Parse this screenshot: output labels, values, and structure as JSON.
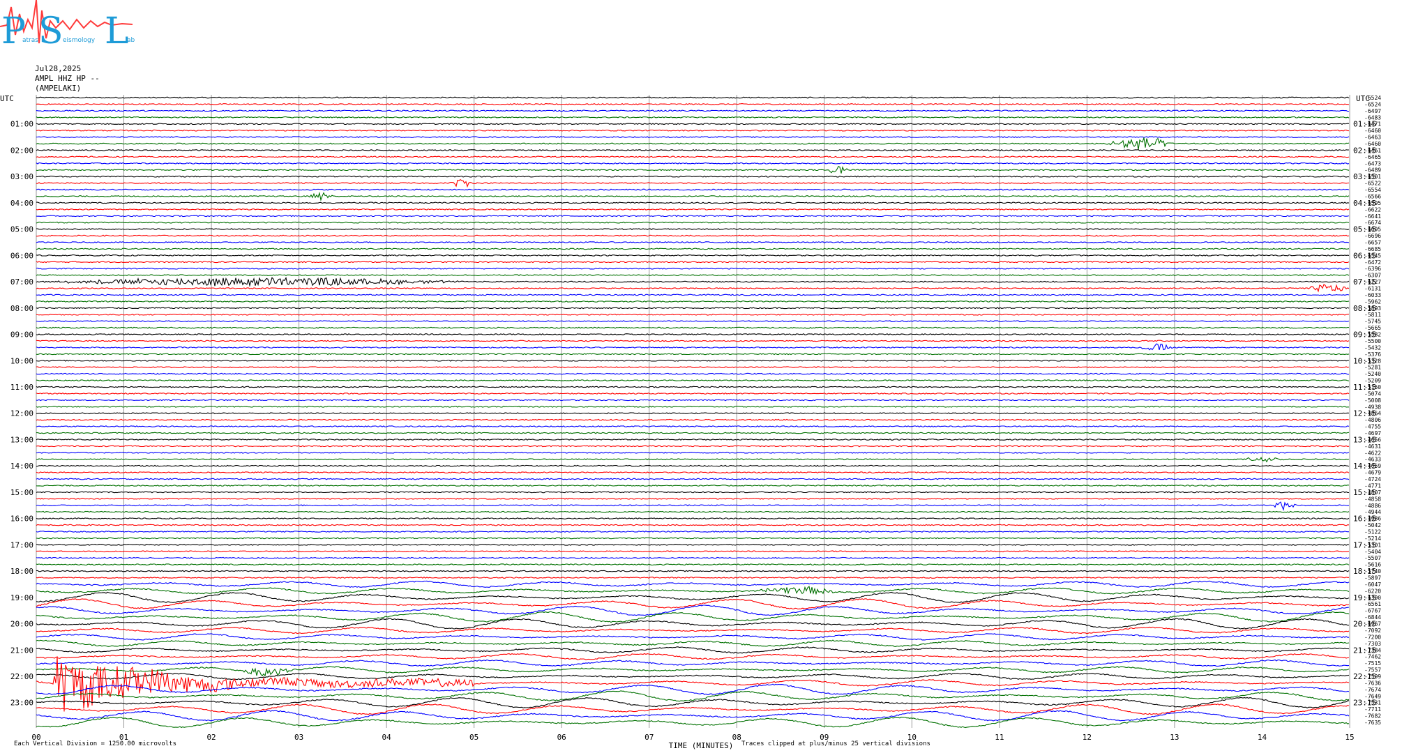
{
  "logo": {
    "letters": [
      "P",
      "S",
      "L"
    ],
    "small_words": [
      "atras",
      "eismology",
      "ab"
    ],
    "colors": {
      "letters": "#1e9bd7",
      "wave": "#ff3b3b"
    }
  },
  "header": {
    "date": "Jul28,2025",
    "station": "AMPL HHZ HP --",
    "site": "(AMPELAKI)"
  },
  "chart_data": {
    "type": "line",
    "title": "",
    "xlabel": "TIME (MINUTES)",
    "x_ticks": [
      "00",
      "01",
      "02",
      "03",
      "04",
      "05",
      "06",
      "07",
      "08",
      "09",
      "10",
      "11",
      "12",
      "13",
      "14",
      "15"
    ],
    "xlim": [
      0,
      15
    ],
    "left_axis_title": "UTC",
    "right_axis_title": "UTC",
    "left_labels": [
      "01:00",
      "02:00",
      "03:00",
      "04:00",
      "05:00",
      "06:00",
      "07:00",
      "08:00",
      "09:00",
      "10:00",
      "11:00",
      "12:00",
      "13:00",
      "14:00",
      "15:00",
      "16:00",
      "17:00",
      "18:00",
      "19:00",
      "20:00",
      "21:00",
      "22:00",
      "23:00"
    ],
    "right_labels": [
      "01:15",
      "02:15",
      "03:15",
      "04:15",
      "05:15",
      "06:15",
      "07:15",
      "08:15",
      "09:15",
      "10:15",
      "11:15",
      "12:15",
      "13:15",
      "14:15",
      "15:15",
      "16:15",
      "17:15",
      "18:15",
      "19:15",
      "20:15",
      "21:15",
      "22:15",
      "23:15"
    ],
    "trace_colors": [
      "#000000",
      "#ff0000",
      "#0000ff",
      "#007000"
    ],
    "trace_count": 96,
    "offsets": [
      -6524,
      -6524,
      -6497,
      -6483,
      -6471,
      -6460,
      -6463,
      -6460,
      -6461,
      -6465,
      -6473,
      -6489,
      -6501,
      -6522,
      -6554,
      -6566,
      -6595,
      -6622,
      -6641,
      -6674,
      -6695,
      -6696,
      -6657,
      -6685,
      -6545,
      -6472,
      -6396,
      -6307,
      -6227,
      -6131,
      -6033,
      -5962,
      -5893,
      -5811,
      -5745,
      -5665,
      -5582,
      -5500,
      -5432,
      -5376,
      -5328,
      -5281,
      -5240,
      -5209,
      -5150,
      -5074,
      -5008,
      -4938,
      -4864,
      -4806,
      -4755,
      -4697,
      -4656,
      -4631,
      -4622,
      -4633,
      -4659,
      -4679,
      -4724,
      -4771,
      -4807,
      -4858,
      -4886,
      -4944,
      -4986,
      -5042,
      -5122,
      -5214,
      -5301,
      -5404,
      -5507,
      -5616,
      -5740,
      -5897,
      -6047,
      -6220,
      -6390,
      -6561,
      -6767,
      -6844,
      -6967,
      -7092,
      -7200,
      -7303,
      -7384,
      -7462,
      -7515,
      -7557,
      -7599,
      -7636,
      -7674,
      -7649,
      -7531,
      -7711,
      -7682,
      -7635
    ],
    "events": [
      {
        "trace": 7,
        "start": 12.2,
        "end": 13.0,
        "amplitude": "large"
      },
      {
        "trace": 11,
        "start": 9.0,
        "end": 9.3,
        "amplitude": "medium"
      },
      {
        "trace": 13,
        "start": 4.7,
        "end": 5.0,
        "amplitude": "medium"
      },
      {
        "trace": 15,
        "start": 3.1,
        "end": 3.4,
        "amplitude": "medium"
      },
      {
        "trace": 28,
        "start": 0.0,
        "end": 5.0,
        "amplitude": "medium"
      },
      {
        "trace": 29,
        "start": 14.5,
        "end": 15.0,
        "amplitude": "medium"
      },
      {
        "trace": 38,
        "start": 12.6,
        "end": 13.0,
        "amplitude": "medium"
      },
      {
        "trace": 55,
        "start": 13.7,
        "end": 14.3,
        "amplitude": "small"
      },
      {
        "trace": 62,
        "start": 14.1,
        "end": 14.4,
        "amplitude": "medium"
      },
      {
        "trace": 75,
        "start": 8.2,
        "end": 9.2,
        "amplitude": "medium"
      },
      {
        "trace": 87,
        "start": 2.3,
        "end": 3.0,
        "amplitude": "medium"
      },
      {
        "trace": 89,
        "start": 0.2,
        "end": 5.0,
        "amplitude": "very-large"
      }
    ],
    "footer": {
      "scale": "Each Vertical Division = 1250.00 microvolts",
      "clip": "Traces clipped at plus/minus 25 vertical divisions"
    },
    "grid": true
  }
}
